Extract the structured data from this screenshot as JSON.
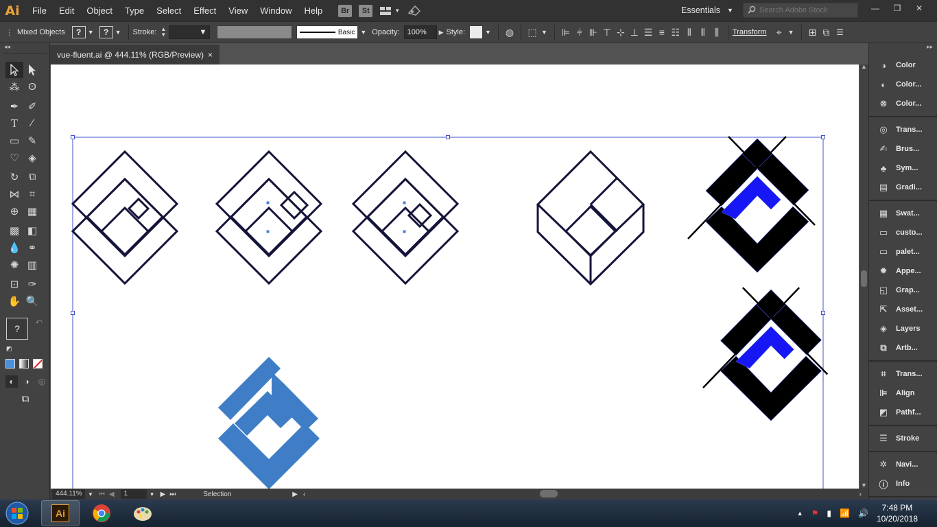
{
  "app": {
    "logo": "Ai",
    "menu": [
      "File",
      "Edit",
      "Object",
      "Type",
      "Select",
      "Effect",
      "View",
      "Window",
      "Help"
    ],
    "bridge": [
      "Br",
      "St"
    ],
    "workspace": "Essentials",
    "search_placeholder": "Search Adobe Stock"
  },
  "control": {
    "selection_label": "Mixed Objects",
    "fill_q": "?",
    "stroke_q": "?",
    "stroke_label": "Stroke:",
    "brush": "Basic",
    "opacity_label": "Opacity:",
    "opacity_value": "100%",
    "style_label": "Style:",
    "transform_label": "Transform"
  },
  "document": {
    "tab_title": "vue-fluent.ai @ 444.11% (RGB/Preview)",
    "close": "×"
  },
  "status": {
    "zoom": "444.11%",
    "page": "1",
    "tool": "Selection"
  },
  "toolbar": {
    "unknown_fill": "?"
  },
  "panels": [
    [
      "Color",
      "Color...",
      "Color..."
    ],
    [
      "Trans...",
      "Brus...",
      "Sym...",
      "Gradi..."
    ],
    [
      "Swat...",
      "custo...",
      "palet...",
      "Appe...",
      "Grap...",
      "Asset...",
      "Layers",
      "Artb..."
    ],
    [
      "Trans...",
      "Align",
      "Pathf..."
    ],
    [
      "Stroke"
    ],
    [
      "Navi...",
      "Info"
    ]
  ],
  "panel_icons": [
    [
      "color-icon",
      "color-guide-icon",
      "color-themes-icon"
    ],
    [
      "transparency-icon",
      "brushes-icon",
      "symbols-icon",
      "gradient-icon"
    ],
    [
      "swatches-icon",
      "library-icon",
      "library-icon",
      "appearance-icon",
      "graphic-styles-icon",
      "asset-export-icon",
      "layers-icon",
      "artboards-icon"
    ],
    [
      "transform-icon",
      "align-icon",
      "pathfinder-icon"
    ],
    [
      "stroke-icon"
    ],
    [
      "navigator-icon",
      "info-icon"
    ]
  ],
  "colors": {
    "logo_blue": "#3f7ec6",
    "vivid_blue": "#1717f5",
    "outline": "#14143a",
    "selection": "#3f51c8"
  },
  "taskbar": {
    "time": "7:48 PM",
    "date": "10/20/2018"
  }
}
